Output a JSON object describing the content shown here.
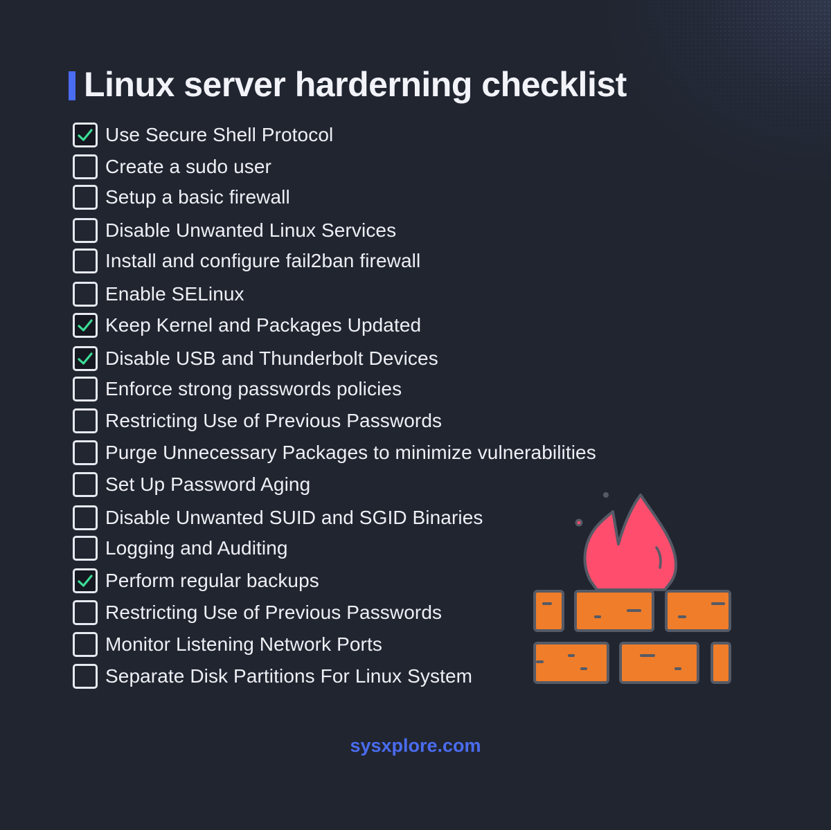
{
  "title": "Linux server harderning checklist",
  "colors": {
    "background": "#212530",
    "accent": "#4a6cf0",
    "check": "#3ddc97",
    "checkbox_border": "#e6e9f0",
    "text": "#eef0f5",
    "flame": "#ff4d6d",
    "brick": "#ef7d2a",
    "outline": "#555a66"
  },
  "checklist": [
    {
      "label": "Use Secure Shell Protocol",
      "checked": true
    },
    {
      "label": "Create a sudo user",
      "checked": false
    },
    {
      "label": "Setup a basic firewall",
      "checked": false
    },
    {
      "label": "Disable Unwanted Linux Services",
      "checked": false
    },
    {
      "label": "Install and configure fail2ban firewall",
      "checked": false
    },
    {
      "label": "Enable SELinux",
      "checked": false
    },
    {
      "label": "Keep Kernel and Packages Updated",
      "checked": true
    },
    {
      "label": "Disable USB and Thunderbolt Devices",
      "checked": true
    },
    {
      "label": "Enforce strong passwords policies",
      "checked": false
    },
    {
      "label": "Restricting Use of Previous Passwords",
      "checked": false
    },
    {
      "label": "Purge Unnecessary Packages to minimize vulnerabilities",
      "checked": false
    },
    {
      "label": "Set Up Password Aging",
      "checked": false
    },
    {
      "label": "Disable Unwanted SUID and SGID Binaries",
      "checked": false
    },
    {
      "label": "Logging and Auditing",
      "checked": false
    },
    {
      "label": "Perform regular backups",
      "checked": true
    },
    {
      "label": "Restricting Use of Previous Passwords",
      "checked": false
    },
    {
      "label": "Monitor Listening Network Ports",
      "checked": false
    },
    {
      "label": "Separate Disk Partitions For Linux System",
      "checked": false
    }
  ],
  "illustration": {
    "icon": "firewall-icon",
    "description": "flame above brick wall"
  },
  "footer": {
    "website": "sysxplore.com"
  }
}
